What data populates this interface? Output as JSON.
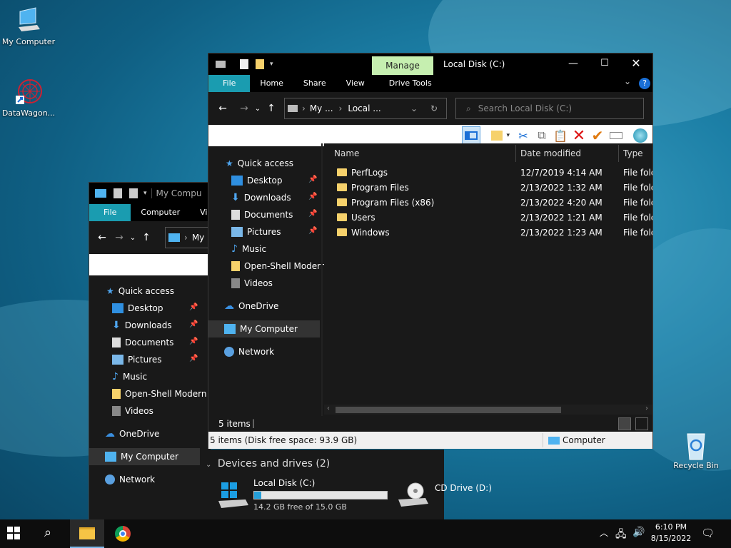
{
  "desktop": {
    "icons": [
      {
        "label": "My Computer"
      },
      {
        "label": "DataWagon..."
      },
      {
        "label": "Recycle Bin"
      }
    ]
  },
  "back_window": {
    "title": "My Compu",
    "tabs": [
      "File",
      "Computer",
      "View"
    ],
    "address": "My",
    "nav": [
      {
        "label": "Quick access"
      },
      {
        "label": "Desktop"
      },
      {
        "label": "Downloads"
      },
      {
        "label": "Documents"
      },
      {
        "label": "Pictures"
      },
      {
        "label": "Music"
      },
      {
        "label": "Open-Shell Modern"
      },
      {
        "label": "Videos"
      },
      {
        "label": "OneDrive"
      },
      {
        "label": "My Computer"
      },
      {
        "label": "Network"
      }
    ],
    "devices_heading": "Devices and drives (2)",
    "drives": [
      {
        "name": "Local Disk (C:)",
        "free": "14.2 GB free of 15.0 GB",
        "used_fraction": 0.053
      },
      {
        "name": "CD Drive (D:)",
        "free": ""
      }
    ]
  },
  "front_window": {
    "title": "Local Disk (C:)",
    "manage_label": "Manage",
    "tabs": [
      "File",
      "Home",
      "Share",
      "View",
      "Drive Tools"
    ],
    "address_parts": [
      "My ...",
      "Local ..."
    ],
    "search_placeholder": "Search Local Disk (C:)",
    "nav": [
      {
        "label": "Quick access"
      },
      {
        "label": "Desktop"
      },
      {
        "label": "Downloads"
      },
      {
        "label": "Documents"
      },
      {
        "label": "Pictures"
      },
      {
        "label": "Music"
      },
      {
        "label": "Open-Shell Modern"
      },
      {
        "label": "Videos"
      },
      {
        "label": "OneDrive"
      },
      {
        "label": "My Computer"
      },
      {
        "label": "Network"
      }
    ],
    "columns": {
      "name": "Name",
      "date": "Date modified",
      "type": "Type"
    },
    "files": [
      {
        "name": "PerfLogs",
        "date": "12/7/2019 4:14 AM",
        "type": "File folde"
      },
      {
        "name": "Program Files",
        "date": "2/13/2022 1:32 AM",
        "type": "File folde"
      },
      {
        "name": "Program Files (x86)",
        "date": "2/13/2022 4:20 AM",
        "type": "File folde"
      },
      {
        "name": "Users",
        "date": "2/13/2022 1:21 AM",
        "type": "File folde"
      },
      {
        "name": "Windows",
        "date": "2/13/2022 1:23 AM",
        "type": "File folde"
      }
    ],
    "status_items": "5 items",
    "status_bar_text": "5 items (Disk free space: 93.9 GB)",
    "status_bar_location": "Computer"
  },
  "taskbar": {
    "time": "6:10 PM",
    "date": "8/15/2022"
  },
  "colors": {
    "accent": "#1a9cb0",
    "manage_tab": "#c6efb0"
  }
}
